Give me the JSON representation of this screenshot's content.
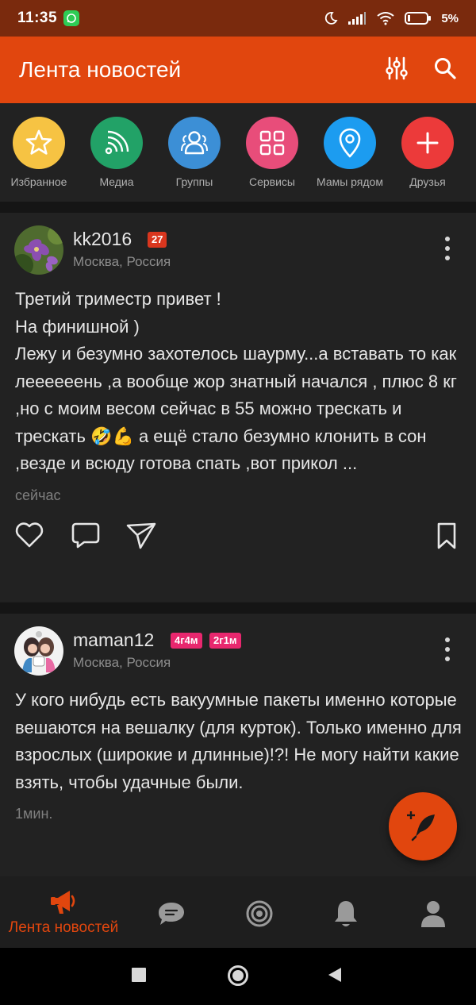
{
  "status_bar": {
    "time": "11:35",
    "battery": "5%"
  },
  "app_bar": {
    "title": "Лента новостей"
  },
  "shortcuts": [
    {
      "label": "Избранное",
      "icon": "star-icon",
      "color": "#f6c343"
    },
    {
      "label": "Медиа",
      "icon": "media-rss-icon",
      "color": "#22a267"
    },
    {
      "label": "Группы",
      "icon": "group-icon",
      "color": "#3c8fd6"
    },
    {
      "label": "Сервисы",
      "icon": "grid-icon",
      "color": "#e84d7a"
    },
    {
      "label": "Мамы рядом",
      "icon": "location-pin-icon",
      "color": "#1c9cf0"
    },
    {
      "label": "Друзья",
      "icon": "plus-icon",
      "color": "#ec3a3a"
    }
  ],
  "posts": [
    {
      "username": "kk2016",
      "badges": [
        "27"
      ],
      "location": "Москва, Россия",
      "text": "Третий триместр привет !\nНа финишной )\nЛежу и безумно захотелось шаурму...а вставать то как леееееень ,а вообще жор знатный начался , плюс 8 кг ,но с моим весом сейчас в 55 можно трескать и трескать 🤣💪 а ещё стало безумно клонить в сон ,везде и всюду готова спать ,вот прикол ...",
      "time": "сейчас"
    },
    {
      "username": "maman12",
      "badges": [
        "4г4м",
        "2г1м"
      ],
      "location": "Москва, Россия",
      "text": "У кого нибудь есть вакуумные пакеты именно которые вешаются на вешалку (для курток). Только именно для взрослых (широкие и длинные)!?!  Не могу найти какие взять, чтобы удачные были.",
      "time": "1мин."
    }
  ],
  "bottom_nav": {
    "active_label": "Лента новостей"
  },
  "colors": {
    "accent": "#e1460e",
    "badge_level": "#d9361e",
    "badge_kids": "#e8276e"
  }
}
